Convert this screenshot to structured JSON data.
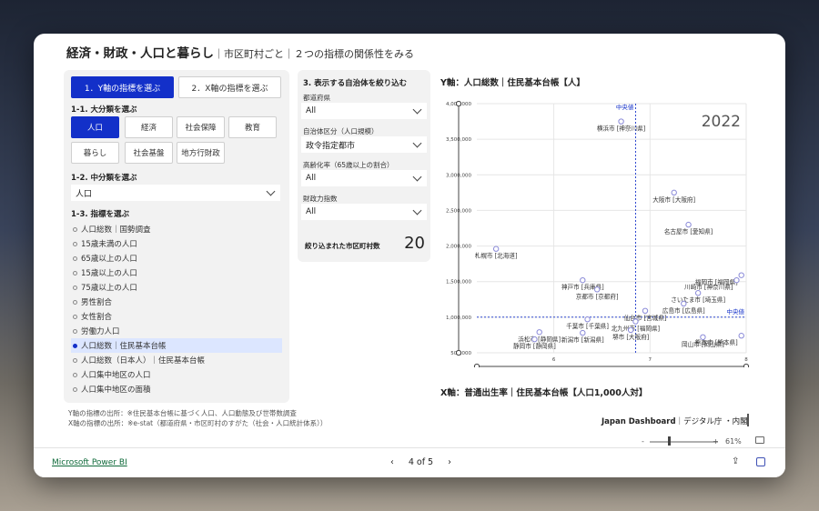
{
  "report": {
    "title": "経済・財政・人口と暮らし",
    "subtitle": "｜市区町村ごと｜２つの指標の関係性をみる"
  },
  "tabs": [
    "1．Y軸の指標を選ぶ",
    "2．X軸の指標を選ぶ"
  ],
  "left": {
    "cat_label": "1-1. 大分類を選ぶ",
    "categories": [
      "人口",
      "経済",
      "社会保障",
      "教育",
      "暮らし",
      "社会基盤",
      "地方行財政"
    ],
    "sub_label": "1-2. 中分類を選ぶ",
    "sub_value": "人口",
    "ind_label": "1-3. 指標を選ぶ",
    "indicators": [
      "人口総数｜国勢調査",
      "15歳未満の人口",
      "65歳以上の人口",
      "15歳以上の人口",
      "75歳以上の人口",
      "男性割合",
      "女性割合",
      "労働力人口",
      "人口総数｜住民基本台帳",
      "人口総数（日本人）｜住民基本台帳",
      "人口集中地区の人口",
      "人口集中地区の面積"
    ]
  },
  "mid": {
    "title": "3. 表示する自治体を絞り込む",
    "pref_label": "都道府県",
    "pref_value": "All",
    "type_label": "自治体区分（人口規模）",
    "type_value": "政令指定都市",
    "aging_label": "高齢化率（65歳以上の割合）",
    "aging_value": "All",
    "fiscal_label": "財政力指数",
    "fiscal_value": "All",
    "count_label": "絞り込まれた市区町村数",
    "count_value": "20"
  },
  "chart_titles": {
    "y": "Y軸：人口総数｜住民基本台帳【人】",
    "x": "X軸：普通出生率｜住民基本台帳【人口1,000人対】"
  },
  "sources": {
    "y": "Y軸の指標の出所：※住民基本台帳に基づく人口、人口動態及び世帯数調査",
    "x": "X軸の指標の出所：※e-stat（都道府県・市区町村のすがた（社会・人口統計体系））"
  },
  "brand": {
    "name": "Japan Dashboard",
    "suffix": "｜デジタル庁 ・内閣"
  },
  "zoom": {
    "minus": "-",
    "plus": "+",
    "level": "61%",
    "percent": 61
  },
  "footer": {
    "pbi": "Microsoft Power BI",
    "prev": "‹",
    "page": "4 of 5",
    "next": "›"
  },
  "chart_data": {
    "type": "scatter",
    "year_label": "2022",
    "median_label": "中央値",
    "xlim": [
      5.2,
      8.0
    ],
    "ylim": [
      500000,
      4000000
    ],
    "xticks": [
      6,
      7,
      8
    ],
    "yticks": [
      500000,
      1000000,
      1500000,
      2000000,
      2500000,
      3000000,
      3500000,
      4000000
    ],
    "ytick_labels": [
      "500,000",
      "1,000,000",
      "1,500,000",
      "2,000,000",
      "2,500,000",
      "3,000,000",
      "3,500,000",
      "4,000,000"
    ],
    "median_x": 6.85,
    "median_y": 1000000,
    "points": [
      {
        "label": "横浜市 [神奈川県]",
        "x": 6.7,
        "y": 3750000
      },
      {
        "label": "大阪市 [大阪府]",
        "x": 7.25,
        "y": 2750000
      },
      {
        "label": "名古屋市 [愛知県]",
        "x": 7.4,
        "y": 2300000
      },
      {
        "label": "札幌市 [北海道]",
        "x": 5.4,
        "y": 1960000
      },
      {
        "label": "福岡市 [福岡県]",
        "x": 7.95,
        "y": 1590000
      },
      {
        "label": "川崎市 [神奈川県]",
        "x": 7.9,
        "y": 1520000
      },
      {
        "label": "神戸市 [兵庫県]",
        "x": 6.3,
        "y": 1520000
      },
      {
        "label": "京都市 [京都府]",
        "x": 6.45,
        "y": 1390000
      },
      {
        "label": "さいたま市 [埼玉県]",
        "x": 7.5,
        "y": 1340000
      },
      {
        "label": "広島市 [広島県]",
        "x": 7.35,
        "y": 1190000
      },
      {
        "label": "仙台市 [宮城県]",
        "x": 6.95,
        "y": 1090000
      },
      {
        "label": "千葉市 [千葉県]",
        "x": 6.35,
        "y": 970000
      },
      {
        "label": "北九州市 [福岡県]",
        "x": 6.85,
        "y": 940000
      },
      {
        "label": "堺市 [大阪府]",
        "x": 6.8,
        "y": 820000
      },
      {
        "label": "新潟市 [新潟県]",
        "x": 6.3,
        "y": 780000
      },
      {
        "label": "浜松市 [静岡県]",
        "x": 5.85,
        "y": 790000
      },
      {
        "label": "静岡市 [静岡県]",
        "x": 5.8,
        "y": 690000
      },
      {
        "label": "熊本市 [熊本県]",
        "x": 7.95,
        "y": 740000
      },
      {
        "label": "岡山市 [岡山県]",
        "x": 7.55,
        "y": 720000
      }
    ]
  }
}
